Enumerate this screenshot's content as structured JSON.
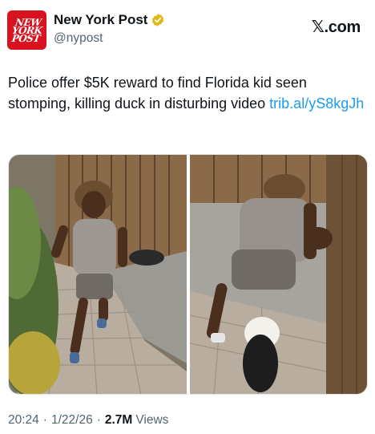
{
  "account": {
    "avatar_text": "New\nYork\nPost",
    "display_name": "New York Post",
    "handle": "@nypost",
    "verified_icon": "verified-badge-icon",
    "avatar_color": "#d8121e",
    "verified_color": "#e2b719"
  },
  "brand": {
    "label": "𝕏.com"
  },
  "tweet": {
    "text": "Police offer $5K reward to find Florida kid seen stomping, killing duck in disturbing video ",
    "link": "trib.al/yS8kgJh",
    "link_color": "#1d9bf0"
  },
  "media": {
    "photos": [
      "photo-left",
      "photo-right"
    ]
  },
  "footer": {
    "time": "20:24",
    "date": "1/22/26",
    "views_count": "2.7M",
    "views_label": "Views"
  }
}
